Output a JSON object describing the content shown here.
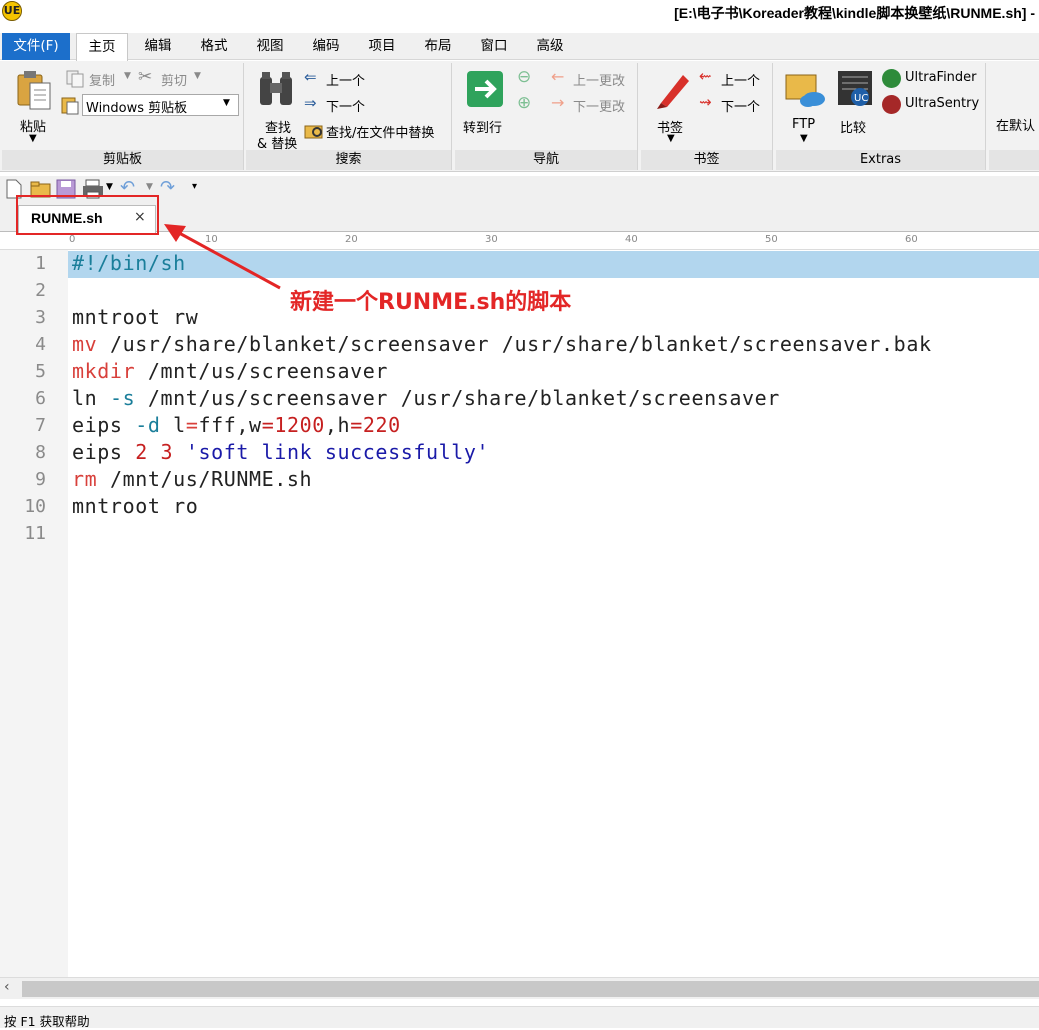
{
  "window": {
    "title": "[E:\\电子书\\Koreader教程\\kindle脚本换壁纸\\RUNME.sh] -",
    "logo": "UE"
  },
  "menu": [
    "文件(F)",
    "主页",
    "编辑",
    "格式",
    "视图",
    "编码",
    "项目",
    "布局",
    "窗口",
    "高级"
  ],
  "ribbon": {
    "clipboard": {
      "paste": "粘贴",
      "copy": "复制",
      "cut": "剪切",
      "select_value": "Windows 剪贴板",
      "title": "剪贴板"
    },
    "search": {
      "find_replace_1": "查找",
      "find_replace_2": "& 替换",
      "prev": "上一个",
      "next": "下一个",
      "find_in_files": "查找/在文件中替换",
      "title": "搜索"
    },
    "navigation": {
      "goto": "转到行",
      "prev_change": "上一更改",
      "next_change": "下一更改",
      "title": "导航"
    },
    "bookmarks": {
      "bookmark": "书签",
      "prev": "上一个",
      "next": "下一个",
      "title": "书签"
    },
    "extras": {
      "ftp": "FTP",
      "compare": "比较",
      "ultrafinder": "UltraFinder",
      "ultrasentry": "UltraSentry",
      "title": "Extras"
    },
    "overflow": "在默认"
  },
  "tab": {
    "label": "RUNME.sh",
    "close": "×"
  },
  "ruler": [
    "0",
    "10",
    "20",
    "30",
    "40",
    "50",
    "60"
  ],
  "line_numbers": [
    "1",
    "2",
    "3",
    "4",
    "5",
    "6",
    "7",
    "8",
    "9",
    "10",
    "11"
  ],
  "code": [
    [
      {
        "t": "#!/bin/sh",
        "c": "g"
      }
    ],
    [],
    [
      {
        "t": "mntroot rw",
        "c": ""
      }
    ],
    [
      {
        "t": "mv",
        "c": "k"
      },
      {
        "t": " /usr/share/blanket/screensaver /usr/share/blanket/screensaver.bak",
        "c": ""
      }
    ],
    [
      {
        "t": "mkdir",
        "c": "k"
      },
      {
        "t": " /mnt/us/screensaver",
        "c": ""
      }
    ],
    [
      {
        "t": "ln ",
        "c": ""
      },
      {
        "t": "-s",
        "c": "g"
      },
      {
        "t": " /mnt/us/screensaver /usr/share/blanket/screensaver",
        "c": ""
      }
    ],
    [
      {
        "t": "eips ",
        "c": ""
      },
      {
        "t": "-d",
        "c": "g"
      },
      {
        "t": " l",
        "c": ""
      },
      {
        "t": "=",
        "c": "k"
      },
      {
        "t": "fff,w",
        "c": ""
      },
      {
        "t": "=1200",
        "c": "n"
      },
      {
        "t": ",h",
        "c": ""
      },
      {
        "t": "=220",
        "c": "n"
      }
    ],
    [
      {
        "t": "eips ",
        "c": ""
      },
      {
        "t": "2 3",
        "c": "n"
      },
      {
        "t": " ",
        "c": ""
      },
      {
        "t": "'soft link successfully'",
        "c": "s"
      }
    ],
    [
      {
        "t": "rm",
        "c": "k"
      },
      {
        "t": " /mnt/us/RUNME.sh",
        "c": ""
      }
    ],
    [
      {
        "t": "mntroot ro",
        "c": ""
      }
    ],
    []
  ],
  "status": "按 F1 获取帮助",
  "annotation": "新建一个RUNME.sh的脚本"
}
